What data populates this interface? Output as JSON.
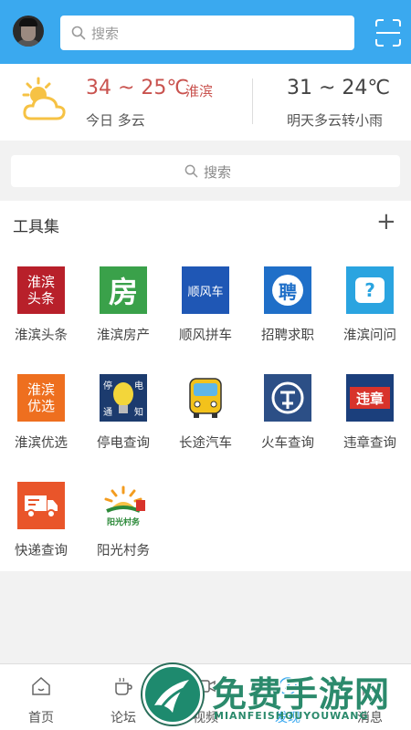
{
  "header": {
    "search_placeholder": "搜索"
  },
  "weather": {
    "today_temp": "34 ~ 25℃",
    "city": "淮滨",
    "today_desc": "今日 多云",
    "tomorrow_temp": "31 ~ 24℃",
    "tomorrow_desc": "明天多云转小雨"
  },
  "search2": {
    "placeholder": "搜索"
  },
  "tools": {
    "title": "工具集",
    "add_label": "+",
    "items": [
      {
        "label": "淮滨头条",
        "icon_text": [
          "淮滨",
          "头条"
        ],
        "icon": "huaibin-headline-icon",
        "color": "#b8202a"
      },
      {
        "label": "淮滨房产",
        "icon_text": [
          "房"
        ],
        "icon": "house-icon",
        "color": "#3aa14a"
      },
      {
        "label": "顺风拼车",
        "icon_text": [
          "顺风车"
        ],
        "icon": "carpool-icon",
        "color": "#1f57b5"
      },
      {
        "label": "招聘求职",
        "icon_text": [
          "聘"
        ],
        "icon": "recruitment-icon",
        "color": "#1f6fc8"
      },
      {
        "label": "淮滨问问",
        "icon_text": [
          "?"
        ],
        "icon": "question-icon",
        "color": "#2aa4e0"
      },
      {
        "label": "淮滨优选",
        "icon_text": [
          "淮滨",
          "优选"
        ],
        "icon": "preferred-icon",
        "color": "#ee6f1f"
      },
      {
        "label": "停电查询",
        "icon_text": [
          "停",
          "电",
          "通",
          "知"
        ],
        "icon": "power-outage-icon",
        "color": "#1c3b6e"
      },
      {
        "label": "长途汽车",
        "icon_text": [],
        "icon": "bus-icon",
        "color": "#f3c21b"
      },
      {
        "label": "火车查询",
        "icon_text": [],
        "icon": "train-icon",
        "color": "#2c4f86"
      },
      {
        "label": "违章查询",
        "icon_text": [
          "违章"
        ],
        "icon": "violation-icon",
        "color": "#1b3f7c"
      },
      {
        "label": "快递查询",
        "icon_text": [],
        "icon": "express-truck-icon",
        "color": "#e9552a"
      },
      {
        "label": "阳光村务",
        "icon_text": [
          "阳光村务"
        ],
        "icon": "sunshine-village-icon",
        "color": "#2d8a3a"
      }
    ]
  },
  "bottom_nav": [
    {
      "label": "首页",
      "icon": "home-icon"
    },
    {
      "label": "论坛",
      "icon": "coffee-cup-icon"
    },
    {
      "label": "视频",
      "icon": "video-icon"
    },
    {
      "label": "发现",
      "icon": "discover-icon"
    },
    {
      "label": "消息",
      "icon": "message-icon"
    }
  ],
  "watermark": {
    "title": "免费手游网",
    "subtitle": "MIANFEISHOUYOUWANG"
  }
}
